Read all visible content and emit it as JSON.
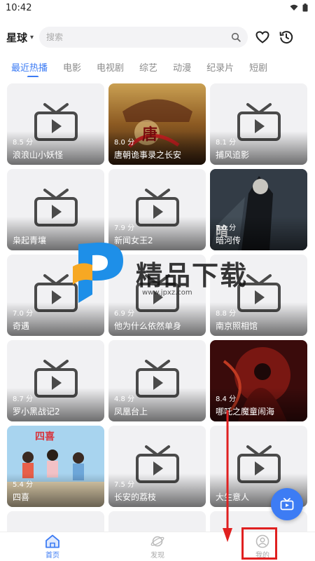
{
  "status_bar": {
    "time": "10:42"
  },
  "header": {
    "title": "星球",
    "search_placeholder": "搜索"
  },
  "tabs": [
    "最近热播",
    "电影",
    "电视剧",
    "综艺",
    "动漫",
    "纪录片",
    "短剧"
  ],
  "active_tab": "最近热播",
  "cards": [
    {
      "rating": "8.5 分",
      "title": "浪浪山小妖怪",
      "poster": "placeholder"
    },
    {
      "rating": "8.0 分",
      "title": "唐朝诡事录之长安",
      "poster": "image"
    },
    {
      "rating": "8.1 分",
      "title": "捕风追影",
      "poster": "placeholder"
    },
    {
      "rating": "",
      "title": "枭起青壤",
      "poster": "placeholder"
    },
    {
      "rating": "7.9 分",
      "title": "新闻女王2",
      "poster": "placeholder"
    },
    {
      "rating": "7.0 分",
      "title": "暗河传",
      "poster": "image"
    },
    {
      "rating": "7.0 分",
      "title": "奇遇",
      "poster": "placeholder"
    },
    {
      "rating": "6.9 分",
      "title": "他为什么依然单身",
      "poster": "placeholder"
    },
    {
      "rating": "8.8 分",
      "title": "南京照相馆",
      "poster": "placeholder"
    },
    {
      "rating": "8.7 分",
      "title": "罗小黑战记2",
      "poster": "placeholder"
    },
    {
      "rating": "4.8 分",
      "title": "凤凰台上",
      "poster": "placeholder"
    },
    {
      "rating": "8.4 分",
      "title": "哪吒之魔童闹海",
      "poster": "image"
    },
    {
      "rating": "5.4 分",
      "title": "四喜",
      "poster": "image"
    },
    {
      "rating": "7.5 分",
      "title": "长安的荔枝",
      "poster": "placeholder"
    },
    {
      "rating": "",
      "title": "大生意人",
      "poster": "placeholder"
    }
  ],
  "bottom_nav": [
    {
      "label": "首页",
      "icon": "home-icon",
      "active": true
    },
    {
      "label": "发现",
      "icon": "planet-icon",
      "active": false
    },
    {
      "label": "我的",
      "icon": "user-icon",
      "active": false
    }
  ],
  "watermark": {
    "text": "精品下载",
    "url": "www.jpxz.com"
  },
  "colors": {
    "accent": "#3d7cf4",
    "annotation": "#e02020"
  }
}
